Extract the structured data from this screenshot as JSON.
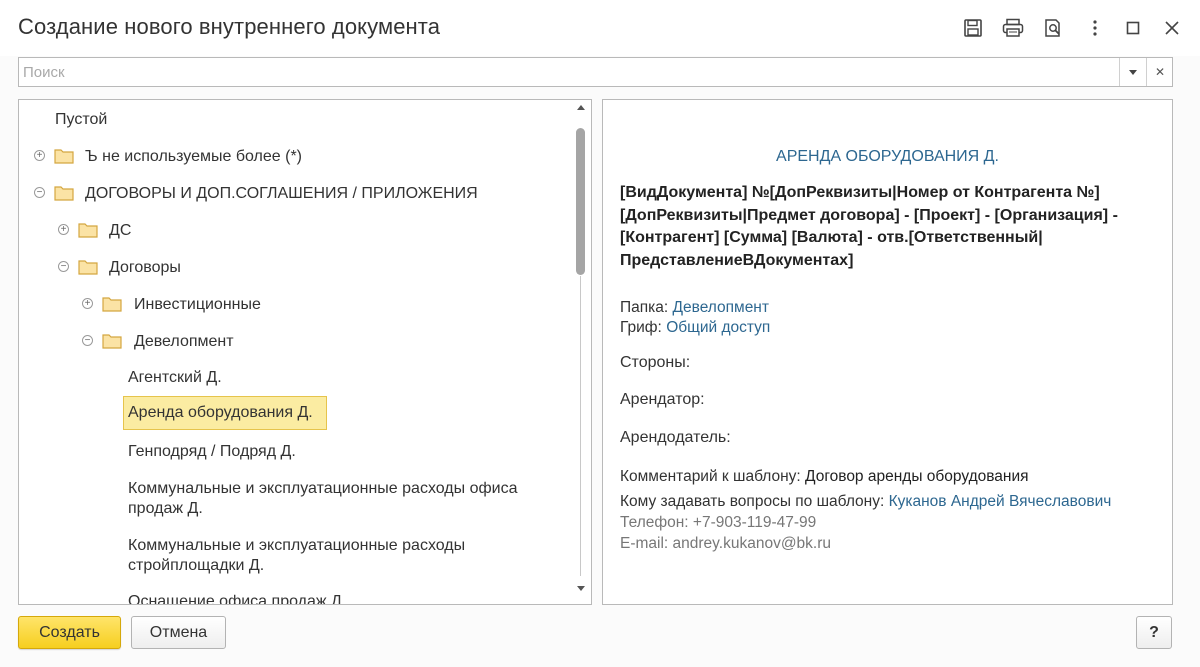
{
  "window": {
    "title": "Создание нового внутреннего документа"
  },
  "titlebar_icons": [
    "save-icon",
    "print-icon",
    "print-preview-icon",
    "more-vert-icon",
    "maximize-icon",
    "close-icon"
  ],
  "search": {
    "placeholder": "Поиск",
    "value": ""
  },
  "tree": {
    "items": [
      {
        "label": "Пустой",
        "level": 0,
        "type": "leaf"
      },
      {
        "label": "Ъ не используемые более (*)",
        "level": 0,
        "type": "folder",
        "expanded": false
      },
      {
        "label": "ДОГОВОРЫ И ДОП.СОГЛАШЕНИЯ / ПРИЛОЖЕНИЯ",
        "level": 0,
        "type": "folder",
        "expanded": true
      },
      {
        "label": "ДС",
        "level": 1,
        "type": "folder",
        "expanded": false
      },
      {
        "label": "Договоры",
        "level": 1,
        "type": "folder",
        "expanded": true
      },
      {
        "label": "Инвестиционные",
        "level": 2,
        "type": "folder",
        "expanded": false
      },
      {
        "label": "Девелопмент",
        "level": 2,
        "type": "folder",
        "expanded": true
      },
      {
        "label": "Агентский Д.",
        "level": 3,
        "type": "leaf"
      },
      {
        "label": "Аренда оборудования Д.",
        "level": 3,
        "type": "leaf",
        "selected": true
      },
      {
        "label": "Генподряд / Подряд Д.",
        "level": 3,
        "type": "leaf"
      },
      {
        "label_line1": "Коммунальные и эксплуатационные расходы офиса",
        "label_line2": "продаж Д.",
        "level": 3,
        "type": "leaf"
      },
      {
        "label_line1": "Коммунальные и эксплуатационные расходы",
        "label_line2": "стройплощадки Д.",
        "level": 3,
        "type": "leaf"
      },
      {
        "label": "Оснащение офиса продаж Д.",
        "level": 3,
        "type": "leaf"
      }
    ]
  },
  "preview": {
    "title": "АРЕНДА ОБОРУДОВАНИЯ Д.",
    "name_template_lines": [
      "[ВидДокумента] №[ДопРеквизиты|Номер от Контрагента №]",
      "[ДопРеквизиты|Предмет договора] - [Проект] - [Организация] -",
      "[Контрагент] [Сумма] [Валюта] - отв.[Ответственный|",
      "ПредставлениеВДокументах]"
    ],
    "folder_label": "Папка:",
    "folder_value": "Девелопмент",
    "grif_label": "Гриф:",
    "grif_value": "Общий доступ",
    "parties_label": "Стороны:",
    "tenant_label": "Арендатор:",
    "landlord_label": "Арендодатель:",
    "comment_label": "Комментарий к шаблону:",
    "comment_value": "Договор аренды оборудования",
    "contact_label": "Кому задавать вопросы по шаблону:",
    "contact_value": "Куканов Андрей Вячеславович",
    "phone": "Телефон: +7-903-119-47-99",
    "email": "E-mail: andrey.kukanov@bk.ru"
  },
  "buttons": {
    "create": "Создать",
    "cancel": "Отмена",
    "help": "?"
  },
  "colors": {
    "accent_yellow": "#f6cf1f",
    "selection_bg": "#fbeca2",
    "link_blue": "#2d6790"
  }
}
